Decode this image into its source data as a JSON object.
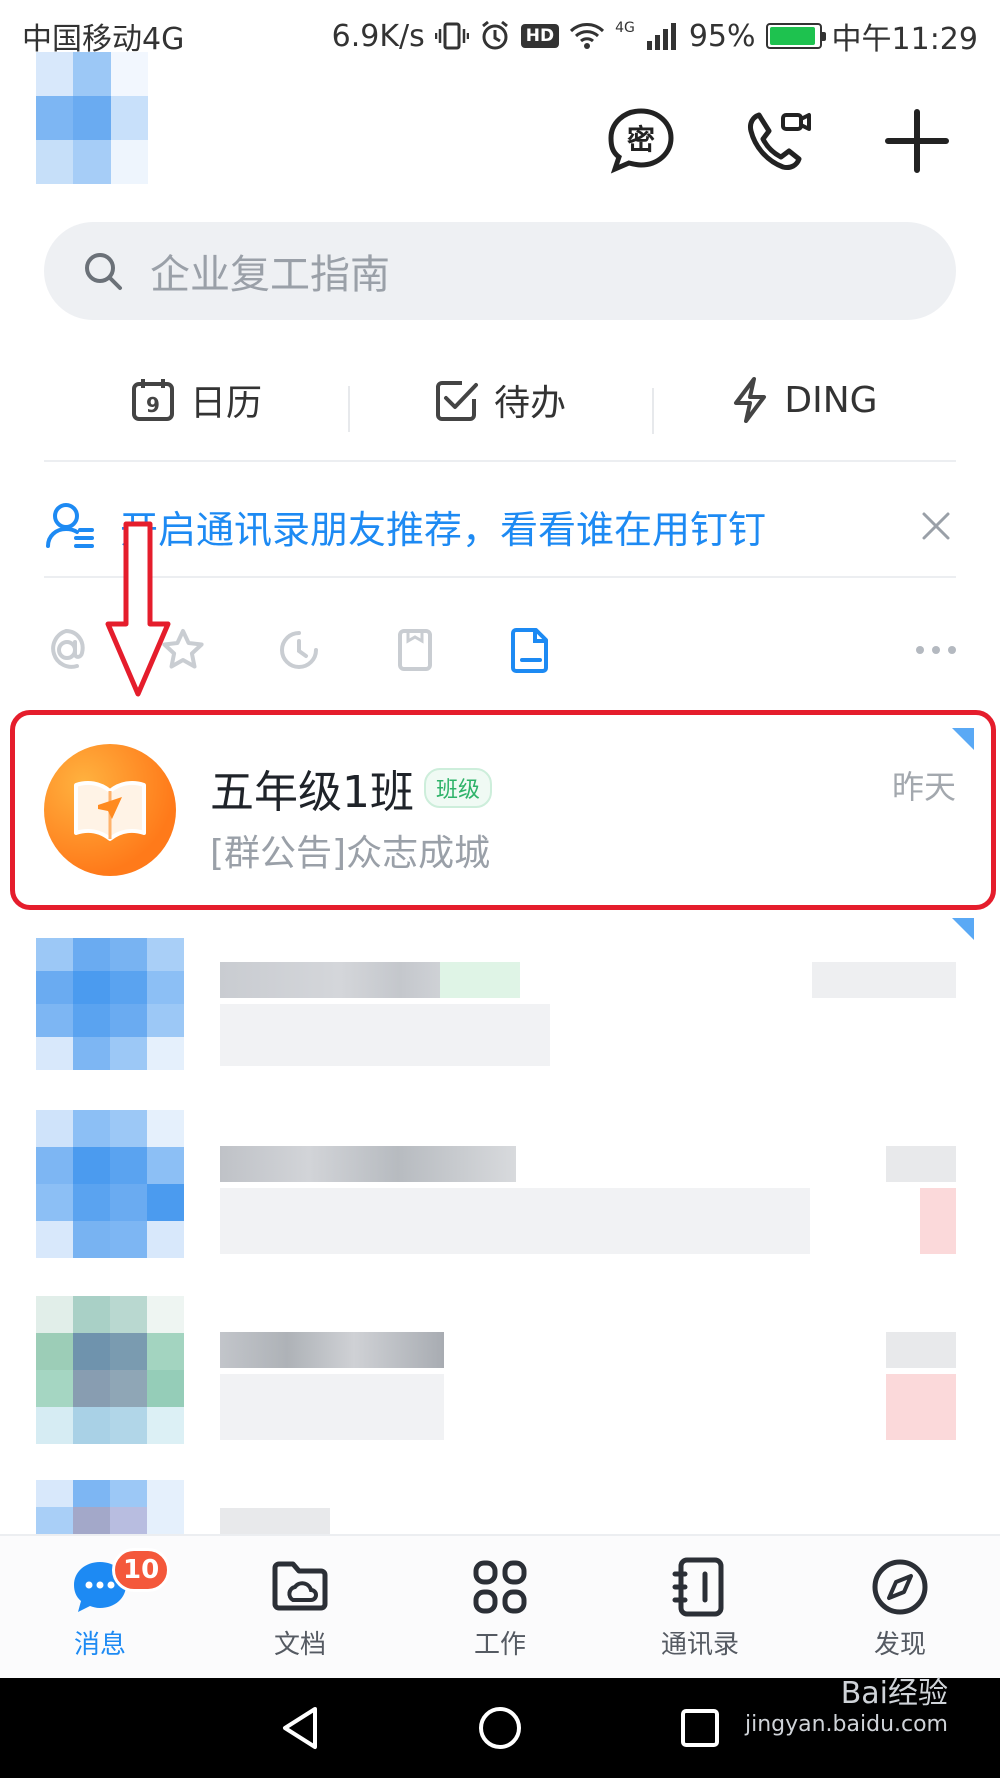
{
  "status_bar": {
    "carrier": "中国移动4G",
    "net_speed": "6.9K/s",
    "hd_badge": "HD",
    "signal_label": "4G",
    "battery": "95%",
    "time": "中午11:29"
  },
  "header": {
    "actions": [
      {
        "name": "secret-chat-icon",
        "label": "密"
      },
      {
        "name": "video-call-icon"
      },
      {
        "name": "add-icon"
      }
    ]
  },
  "search": {
    "placeholder": "企业复工指南"
  },
  "quick_actions": [
    {
      "icon": "calendar-icon",
      "label": "日历",
      "icon_text": "9"
    },
    {
      "icon": "todo-icon",
      "label": "待办"
    },
    {
      "icon": "lightning-icon",
      "label": "DING"
    }
  ],
  "banner": {
    "text": "开启通讯录朋友推荐，看看谁在用钉钉"
  },
  "filters": [
    "at-icon",
    "star-icon",
    "clock-icon",
    "inbox-icon",
    "document-icon",
    "more-icon"
  ],
  "highlighted_chat": {
    "name": "五年级1班",
    "tag": "班级",
    "time": "昨天",
    "preview": "[群公告]众志成城"
  },
  "tabbar": {
    "tabs": [
      {
        "icon": "message-icon",
        "label": "消息",
        "active": true,
        "badge": "10"
      },
      {
        "icon": "docs-icon",
        "label": "文档"
      },
      {
        "icon": "work-icon",
        "label": "工作"
      },
      {
        "icon": "contacts-icon",
        "label": "通讯录"
      },
      {
        "icon": "discover-icon",
        "label": "发现"
      }
    ]
  },
  "colors": {
    "accent": "#1d8af3",
    "highlight": "#e51d2c",
    "badge": "#f4583b",
    "logo": "#ff8a1f"
  },
  "watermark": {
    "brand": "Bai经验",
    "url": "jingyan.baidu.com"
  }
}
